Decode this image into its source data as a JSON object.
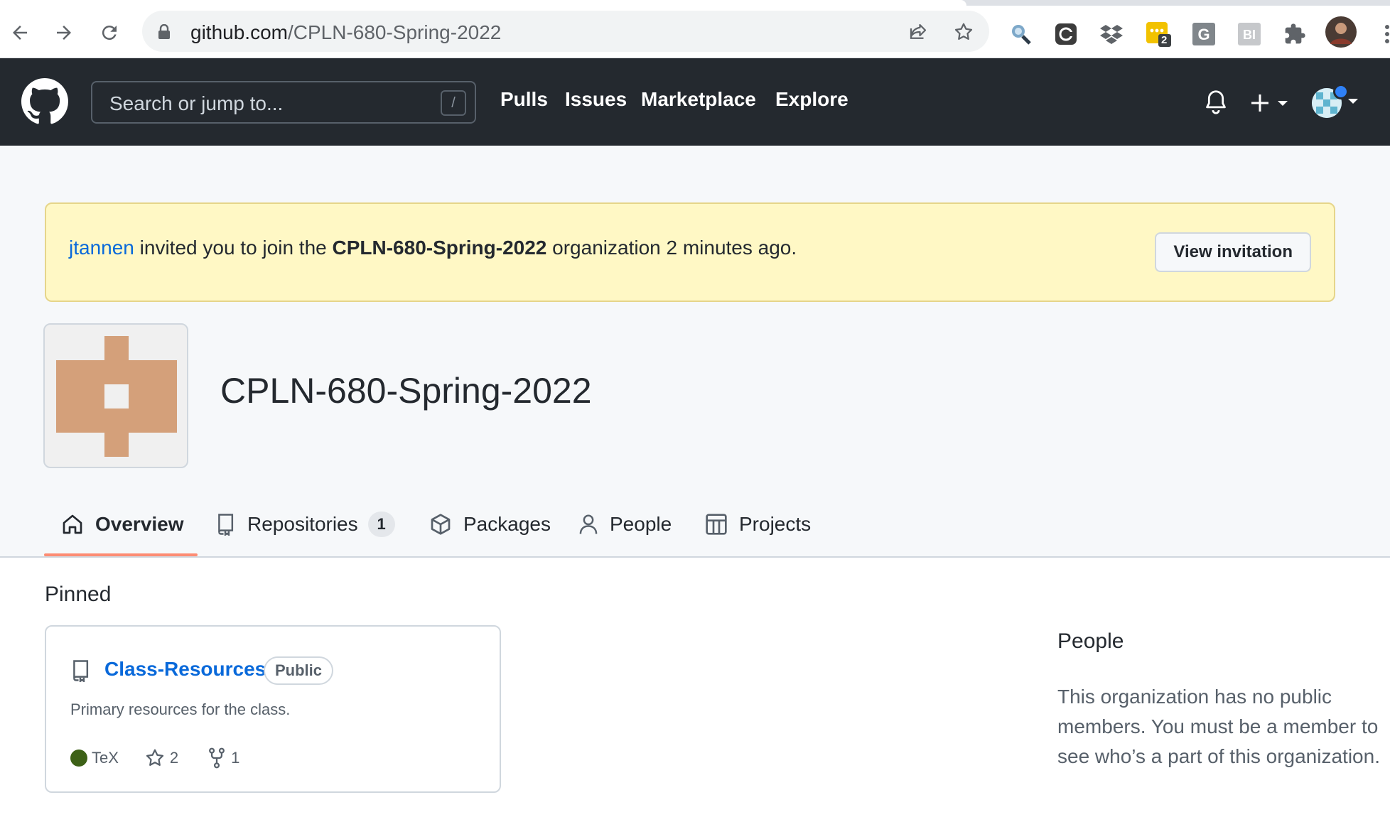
{
  "browser": {
    "url_host": "github.com",
    "url_path": "/CPLN-680-Spring-2022",
    "extension_badge": "2"
  },
  "header": {
    "search_placeholder": "Search or jump to...",
    "search_shortcut": "/",
    "nav": [
      "Pulls",
      "Issues",
      "Marketplace",
      "Explore"
    ]
  },
  "flash": {
    "inviter": "jtannen",
    "text_before": "invited you to join the",
    "org": "CPLN-680-Spring-2022",
    "text_after": "organization 2 minutes ago.",
    "button": "View invitation"
  },
  "org": {
    "name": "CPLN-680-Spring-2022",
    "avatar_color": "#d4a07a"
  },
  "tabs": [
    {
      "label": "Overview",
      "icon": "home-icon",
      "active": true
    },
    {
      "label": "Repositories",
      "icon": "repo-icon",
      "count": "1"
    },
    {
      "label": "Packages",
      "icon": "package-icon"
    },
    {
      "label": "People",
      "icon": "person-icon"
    },
    {
      "label": "Projects",
      "icon": "project-icon"
    }
  ],
  "pinned": {
    "title": "Pinned",
    "repo": {
      "name": "Class-Resources",
      "visibility": "Public",
      "description": "Primary resources for the class.",
      "language": "TeX",
      "language_color": "#3d6117",
      "stars": "2",
      "forks": "1"
    }
  },
  "people": {
    "title": "People",
    "text": "This organization has no public members. You must be a member to see who’s a part of this organization."
  }
}
